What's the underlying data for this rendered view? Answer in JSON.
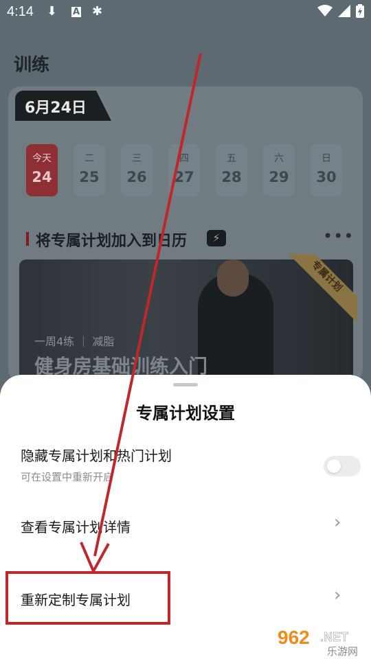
{
  "status_bar": {
    "time": "4:14",
    "icons": [
      "download-icon",
      "a-icon",
      "bug-icon",
      "wifi-icon",
      "signal-icon",
      "battery-charging-icon"
    ]
  },
  "page": {
    "title": "训练",
    "date_tab": "6月24日",
    "days": [
      {
        "name": "今天",
        "num": "24",
        "today": true
      },
      {
        "name": "二",
        "num": "25"
      },
      {
        "name": "三",
        "num": "26"
      },
      {
        "name": "四",
        "num": "27"
      },
      {
        "name": "五",
        "num": "28"
      },
      {
        "name": "六",
        "num": "29"
      },
      {
        "name": "日",
        "num": "30"
      }
    ],
    "section_title": "将专属计划加入到日历",
    "more_label": "•••",
    "plan": {
      "ribbon": "专属计划",
      "subtitle": "一周4练 ｜ 减脂",
      "title": "健身房基础训练入门"
    }
  },
  "sheet": {
    "title": "专属计划设置",
    "hide_label": "隐藏专属计划和热门计划",
    "hide_sub": "可在设置中重新开启",
    "hide_toggle_on": false,
    "view_details_label": "查看专属计划详情",
    "recustomize_label": "重新定制专属计划",
    "chevron": "›"
  },
  "watermark": {
    "number": "962",
    "suffix": ".NET",
    "cn": "乐游网"
  },
  "colors": {
    "highlight": "#c0262a",
    "today_bg": "#8e2f33",
    "dim_overlay": "#5d6a72"
  }
}
